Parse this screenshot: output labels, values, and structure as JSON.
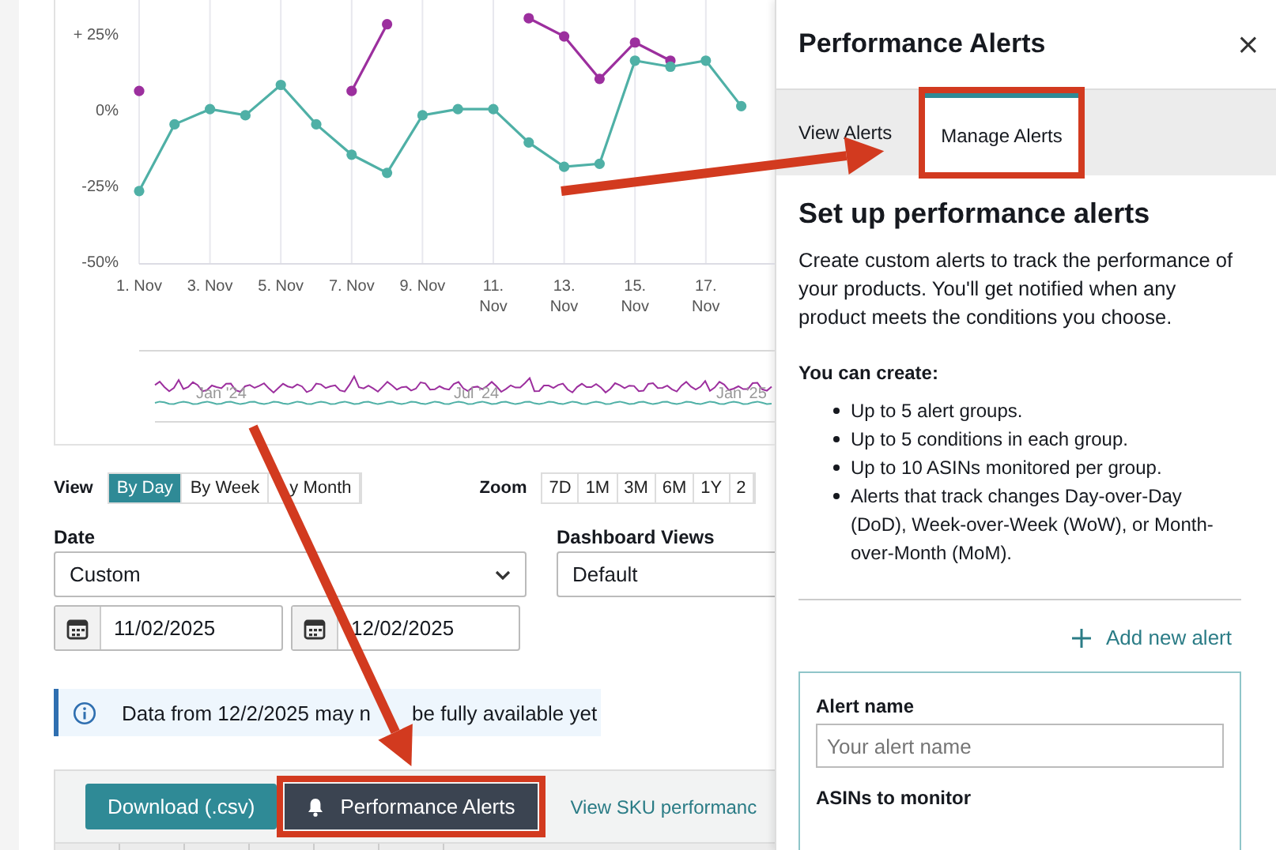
{
  "chart": {
    "chart_data": {
      "type": "line",
      "categories": [
        "1. Nov",
        null,
        "3. Nov",
        null,
        "5. Nov",
        null,
        "7. Nov",
        null,
        "9. Nov",
        null,
        "11. Nov",
        null,
        "13. Nov",
        null,
        "15. Nov",
        null,
        "17. Nov",
        null
      ],
      "yticks": [
        {
          "value": 25,
          "label": "+ 25%"
        },
        {
          "value": 0,
          "label": "0%"
        },
        {
          "value": -25,
          "label": "-25%"
        },
        {
          "value": -50,
          "label": "-50%"
        }
      ],
      "ylim": [
        -50,
        37
      ],
      "grid": true,
      "series": [
        {
          "color": "#9c2f9e",
          "marker": true,
          "values": [
            7,
            null,
            null,
            null,
            null,
            null,
            7,
            29,
            null,
            null,
            null,
            31,
            25,
            11,
            23,
            17,
            null,
            null
          ]
        },
        {
          "color": "#4fb0a6",
          "marker": true,
          "values": [
            -26,
            -4,
            1,
            -1,
            9,
            -4,
            -14,
            -20,
            -1,
            1,
            1,
            -10,
            -18,
            -17,
            17,
            15,
            17,
            2
          ]
        }
      ]
    },
    "navigator_labels": [
      "Jan '24",
      "Jul '24",
      "Jan '25"
    ]
  },
  "view": {
    "label": "View",
    "options": [
      {
        "label": "By Day",
        "selected": true
      },
      {
        "label": "By Week",
        "selected": false
      },
      {
        "label": "y Month",
        "selected": false
      }
    ]
  },
  "zoom": {
    "label": "Zoom",
    "options": [
      {
        "label": "7D",
        "selected": false
      },
      {
        "label": "1M",
        "selected": false
      },
      {
        "label": "3M",
        "selected": false
      },
      {
        "label": "6M",
        "selected": false
      },
      {
        "label": "1Y",
        "selected": false
      },
      {
        "label": "2",
        "selected": false
      }
    ]
  },
  "date": {
    "label": "Date",
    "value": "Custom",
    "from": "11/02/2025",
    "to": "12/02/2025"
  },
  "dashboard_views": {
    "label": "Dashboard Views",
    "value": "Default"
  },
  "notice": [
    "Data from 12/2/2025 may n",
    "be fully available yet"
  ],
  "toolbar": {
    "buttons": [
      {
        "kind": "primary",
        "label": "Download (.csv)",
        "highlighted": false
      },
      {
        "kind": "alerts",
        "label": "Performance Alerts",
        "highlighted": true
      }
    ],
    "link": "View SKU performanc"
  },
  "panel": {
    "title": "Performance Alerts",
    "close": "×",
    "tabs": [
      {
        "label": "View Alerts",
        "selected": false,
        "highlighted": false
      },
      {
        "label": "Manage Alerts",
        "selected": true,
        "highlighted": true
      }
    ],
    "heading": "Set up performance alerts",
    "intro": "Create custom alerts to track the performance of your products. You'll get notified when any product meets the conditions you choose.",
    "list_title": "You can create:",
    "items": [
      "Up to 5 alert groups.",
      "Up to 5 conditions in each group.",
      "Up to 10 ASINs monitored per group.",
      "Alerts that track changes Day-over-Day (DoD), Week-over-Week (WoW), or Month-over-Month (MoM)."
    ],
    "add_link": "Add new alert",
    "form": {
      "field_label": "Alert name",
      "placeholder": "Your alert name",
      "next_label": "ASINs to monitor"
    }
  }
}
